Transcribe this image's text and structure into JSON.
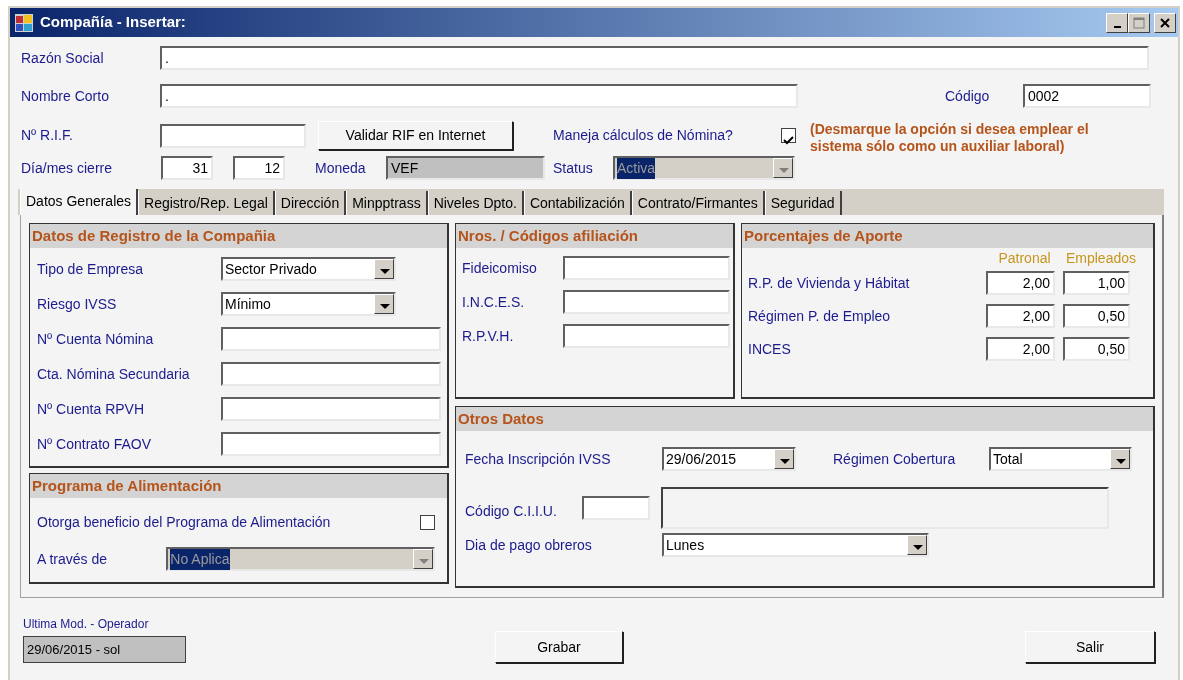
{
  "window": {
    "title": "Compañía - Insertar:"
  },
  "form": {
    "razon_social": {
      "label": "Razón Social",
      "value": "."
    },
    "nombre_corto": {
      "label": "Nombre Corto",
      "value": "."
    },
    "codigo": {
      "label": "Código",
      "value": "0002"
    },
    "rif": {
      "label": "Nº R.I.F."
    },
    "validate_button": "Validar RIF en Internet",
    "nomina": {
      "label": "Maneja cálculos de Nómina?",
      "checked": true
    },
    "nomina_note": "(Desmarque la opción si desea emplear el sistema sólo como un auxiliar laboral)",
    "cierre": {
      "label": "Día/mes cierre",
      "day": "31",
      "month": "12"
    },
    "moneda": {
      "label": "Moneda",
      "value": "VEF",
      "disabled": true
    },
    "status": {
      "label": "Status",
      "value": "Activa",
      "disabled": true
    }
  },
  "tabs": [
    {
      "label": "Datos Generales",
      "selected": true
    },
    {
      "label": "Registro/Rep. Legal",
      "selected": false
    },
    {
      "label": "Dirección",
      "selected": false
    },
    {
      "label": "Minpptrass",
      "selected": false
    },
    {
      "label": "Niveles Dpto.",
      "selected": false
    },
    {
      "label": "Contabilización",
      "selected": false
    },
    {
      "label": "Contrato/Firmantes",
      "selected": false
    },
    {
      "label": "Seguridad",
      "selected": false
    }
  ],
  "registro": {
    "title": "Datos de Registro de la Compañia",
    "rows": [
      {
        "label": "Tipo de Empresa",
        "kind": "combo",
        "value": "Sector Privado"
      },
      {
        "label": "Riesgo IVSS",
        "kind": "combo",
        "value": "Mínimo"
      },
      {
        "label": "Nº Cuenta Nómina",
        "kind": "text"
      },
      {
        "label": "Cta. Nómina Secundaria",
        "kind": "text"
      },
      {
        "label": "Nº Cuenta RPVH",
        "kind": "text"
      },
      {
        "label": "Nº Contrato FAOV",
        "kind": "text"
      }
    ]
  },
  "alimentacion": {
    "title": "Programa de Alimentación",
    "beneficio": {
      "label": "Otorga beneficio del Programa de Alimentación",
      "checked": false
    },
    "via": {
      "label": "A través de",
      "value": "No Aplica",
      "disabled": true
    }
  },
  "afiliacion": {
    "title": "Nros. / Códigos afiliación",
    "rows": [
      {
        "label": "Fideicomiso"
      },
      {
        "label": "I.N.C.E.S."
      },
      {
        "label": "R.P.V.H."
      }
    ]
  },
  "aportes": {
    "title": "Porcentajes de Aporte",
    "columns": [
      "Patronal",
      "Empleados"
    ],
    "rows": [
      {
        "label": "R.P. de Vivienda y Hábitat",
        "patronal": "2,00",
        "empleados": "1,00"
      },
      {
        "label": "Régimen P. de Empleo",
        "patronal": "2,00",
        "empleados": "0,50"
      },
      {
        "label": "INCES",
        "patronal": "2,00",
        "empleados": "0,50"
      }
    ]
  },
  "otros": {
    "title": "Otros Datos",
    "fecha": {
      "label": "Fecha Inscripción IVSS",
      "value": "29/06/2015"
    },
    "cobertura": {
      "label": "Régimen Cobertura",
      "value": "Total"
    },
    "ciiu": {
      "label": "Código C.I.I.U."
    },
    "pago": {
      "label": "Dia de pago obreros",
      "value": "Lunes"
    }
  },
  "footer": {
    "last_mod": {
      "label": "Ultima Mod. - Operador",
      "value": "29/06/2015 - sol"
    },
    "buttons": [
      "Grabar",
      "Salir"
    ]
  }
}
